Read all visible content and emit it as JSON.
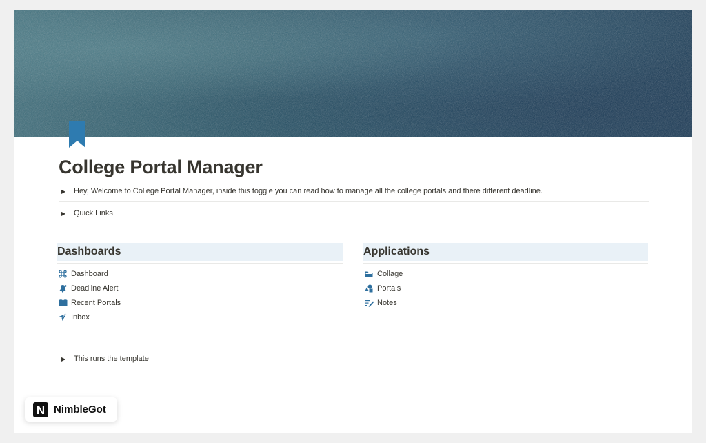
{
  "page": {
    "title": "College Portal Manager",
    "welcome_toggle": "Hey, Welcome to College Portal Manager, inside this toggle you can read how to manage all the college portals and there different deadline.",
    "quick_links_toggle": "Quick Links",
    "template_toggle": "This runs the template"
  },
  "dashboards": {
    "heading": "Dashboards",
    "items": [
      {
        "label": "Dashboard",
        "icon": "command-icon"
      },
      {
        "label": "Deadline Alert",
        "icon": "bell-icon"
      },
      {
        "label": "Recent Portals",
        "icon": "book-icon"
      },
      {
        "label": "Inbox",
        "icon": "paper-plane-icon"
      }
    ]
  },
  "applications": {
    "heading": "Applications",
    "items": [
      {
        "label": "Collage",
        "icon": "folder-icon"
      },
      {
        "label": "Portals",
        "icon": "shapes-icon"
      },
      {
        "label": "Notes",
        "icon": "note-edit-icon"
      }
    ]
  },
  "badge": {
    "logo_letter": "N",
    "label": "NimbleGot"
  },
  "colors": {
    "icon_blue": "#2e6f9e",
    "section_bg": "#e9f1f7",
    "text": "#37352f"
  }
}
